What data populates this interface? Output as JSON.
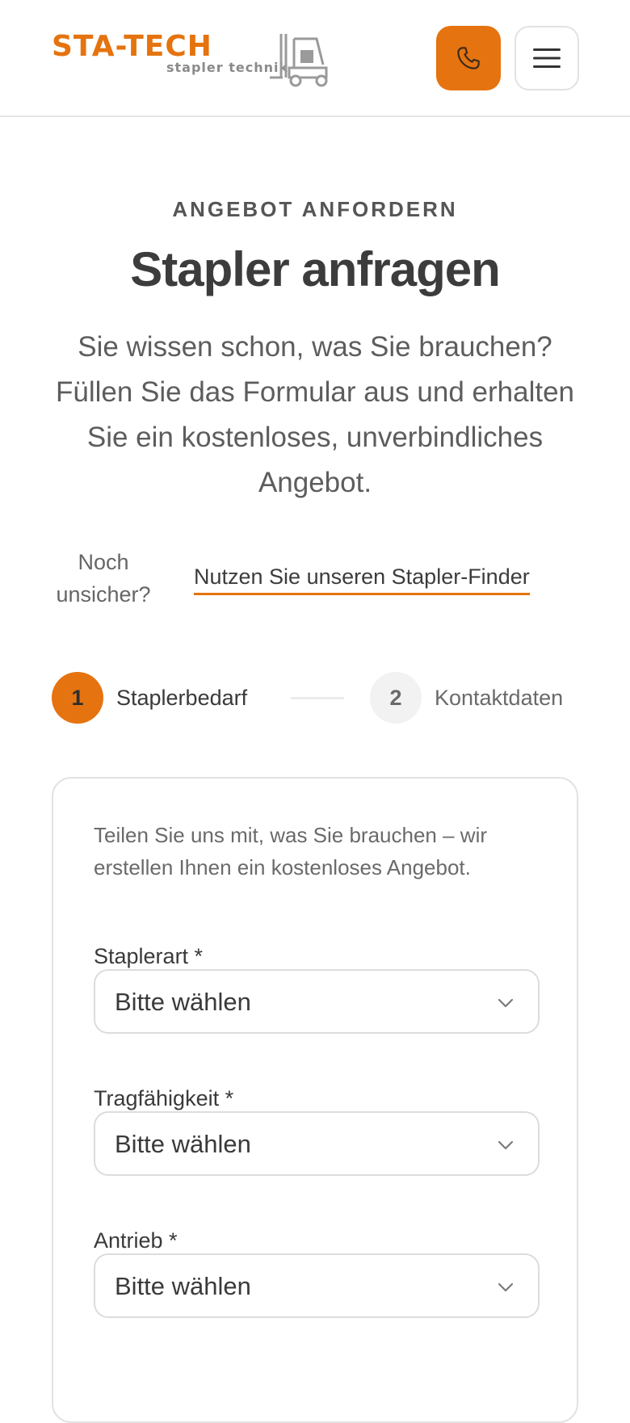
{
  "header": {
    "logo": {
      "brand": "STA-TECH",
      "subtitle": "stapler technik",
      "icon": "forklift-icon"
    },
    "call_button": {
      "icon": "phone-icon"
    },
    "menu_button": {
      "icon": "hamburger-menu-icon"
    }
  },
  "hero": {
    "eyebrow": "ANGEBOT ANFORDERN",
    "title": "Stapler anfragen",
    "lead": "Sie wissen schon, was Sie brauchen? Füllen Sie das Formular aus und erhalten Sie ein kostenloses, unverbindliches Angebot."
  },
  "finder": {
    "prefix": "Noch unsicher?",
    "link": "Nutzen Sie unseren Stapler-Finder"
  },
  "steps": [
    {
      "number": "1",
      "label": "Staplerbedarf",
      "active": true
    },
    {
      "number": "2",
      "label": "Kontaktdaten",
      "active": false
    }
  ],
  "form": {
    "intro": "Teilen Sie uns mit, was Sie brauchen – wir erstellen Ihnen ein kostenloses Angebot.",
    "fields": [
      {
        "label": "Staplerart *",
        "value": "Bitte wählen"
      },
      {
        "label": "Tragfähigkeit *",
        "value": "Bitte wählen"
      },
      {
        "label": "Antrieb *",
        "value": "Bitte wählen"
      }
    ]
  },
  "colors": {
    "accent": "#e5730f",
    "text": "#3c3c3c",
    "muted": "#6a6a6a",
    "border": "#e2e2e2"
  }
}
